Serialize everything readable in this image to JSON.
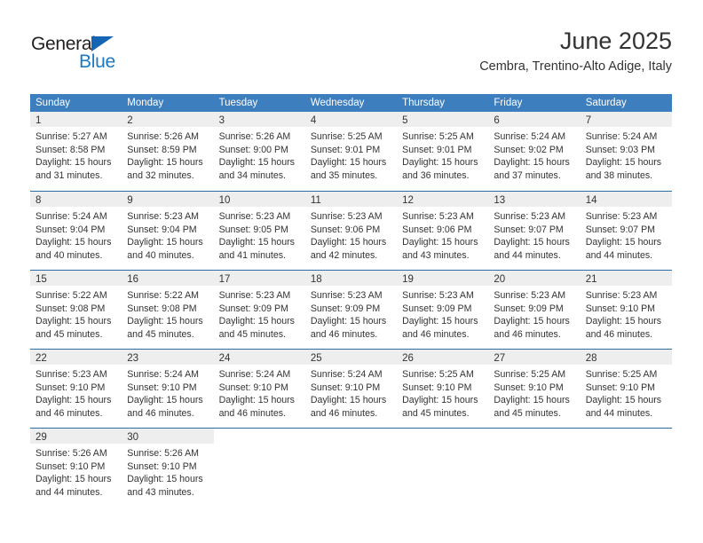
{
  "branding": {
    "logo_text_primary": "General",
    "logo_text_secondary": "Blue",
    "accent_blue": "#1a7ac4",
    "triangle_blue": "#1565b5"
  },
  "header": {
    "title": "June 2025",
    "subtitle": "Cembra, Trentino-Alto Adige, Italy"
  },
  "theme": {
    "header_row_bg": "#3d7ebf",
    "row_divider": "#2e6da4",
    "day_number_bg": "#eeeeee",
    "text_color": "#333333"
  },
  "weekdays": [
    "Sunday",
    "Monday",
    "Tuesday",
    "Wednesday",
    "Thursday",
    "Friday",
    "Saturday"
  ],
  "weeks": [
    [
      {
        "day": "1",
        "lines": [
          "Sunrise: 5:27 AM",
          "Sunset: 8:58 PM",
          "Daylight: 15 hours",
          "and 31 minutes."
        ]
      },
      {
        "day": "2",
        "lines": [
          "Sunrise: 5:26 AM",
          "Sunset: 8:59 PM",
          "Daylight: 15 hours",
          "and 32 minutes."
        ]
      },
      {
        "day": "3",
        "lines": [
          "Sunrise: 5:26 AM",
          "Sunset: 9:00 PM",
          "Daylight: 15 hours",
          "and 34 minutes."
        ]
      },
      {
        "day": "4",
        "lines": [
          "Sunrise: 5:25 AM",
          "Sunset: 9:01 PM",
          "Daylight: 15 hours",
          "and 35 minutes."
        ]
      },
      {
        "day": "5",
        "lines": [
          "Sunrise: 5:25 AM",
          "Sunset: 9:01 PM",
          "Daylight: 15 hours",
          "and 36 minutes."
        ]
      },
      {
        "day": "6",
        "lines": [
          "Sunrise: 5:24 AM",
          "Sunset: 9:02 PM",
          "Daylight: 15 hours",
          "and 37 minutes."
        ]
      },
      {
        "day": "7",
        "lines": [
          "Sunrise: 5:24 AM",
          "Sunset: 9:03 PM",
          "Daylight: 15 hours",
          "and 38 minutes."
        ]
      }
    ],
    [
      {
        "day": "8",
        "lines": [
          "Sunrise: 5:24 AM",
          "Sunset: 9:04 PM",
          "Daylight: 15 hours",
          "and 40 minutes."
        ]
      },
      {
        "day": "9",
        "lines": [
          "Sunrise: 5:23 AM",
          "Sunset: 9:04 PM",
          "Daylight: 15 hours",
          "and 40 minutes."
        ]
      },
      {
        "day": "10",
        "lines": [
          "Sunrise: 5:23 AM",
          "Sunset: 9:05 PM",
          "Daylight: 15 hours",
          "and 41 minutes."
        ]
      },
      {
        "day": "11",
        "lines": [
          "Sunrise: 5:23 AM",
          "Sunset: 9:06 PM",
          "Daylight: 15 hours",
          "and 42 minutes."
        ]
      },
      {
        "day": "12",
        "lines": [
          "Sunrise: 5:23 AM",
          "Sunset: 9:06 PM",
          "Daylight: 15 hours",
          "and 43 minutes."
        ]
      },
      {
        "day": "13",
        "lines": [
          "Sunrise: 5:23 AM",
          "Sunset: 9:07 PM",
          "Daylight: 15 hours",
          "and 44 minutes."
        ]
      },
      {
        "day": "14",
        "lines": [
          "Sunrise: 5:23 AM",
          "Sunset: 9:07 PM",
          "Daylight: 15 hours",
          "and 44 minutes."
        ]
      }
    ],
    [
      {
        "day": "15",
        "lines": [
          "Sunrise: 5:22 AM",
          "Sunset: 9:08 PM",
          "Daylight: 15 hours",
          "and 45 minutes."
        ]
      },
      {
        "day": "16",
        "lines": [
          "Sunrise: 5:22 AM",
          "Sunset: 9:08 PM",
          "Daylight: 15 hours",
          "and 45 minutes."
        ]
      },
      {
        "day": "17",
        "lines": [
          "Sunrise: 5:23 AM",
          "Sunset: 9:09 PM",
          "Daylight: 15 hours",
          "and 45 minutes."
        ]
      },
      {
        "day": "18",
        "lines": [
          "Sunrise: 5:23 AM",
          "Sunset: 9:09 PM",
          "Daylight: 15 hours",
          "and 46 minutes."
        ]
      },
      {
        "day": "19",
        "lines": [
          "Sunrise: 5:23 AM",
          "Sunset: 9:09 PM",
          "Daylight: 15 hours",
          "and 46 minutes."
        ]
      },
      {
        "day": "20",
        "lines": [
          "Sunrise: 5:23 AM",
          "Sunset: 9:09 PM",
          "Daylight: 15 hours",
          "and 46 minutes."
        ]
      },
      {
        "day": "21",
        "lines": [
          "Sunrise: 5:23 AM",
          "Sunset: 9:10 PM",
          "Daylight: 15 hours",
          "and 46 minutes."
        ]
      }
    ],
    [
      {
        "day": "22",
        "lines": [
          "Sunrise: 5:23 AM",
          "Sunset: 9:10 PM",
          "Daylight: 15 hours",
          "and 46 minutes."
        ]
      },
      {
        "day": "23",
        "lines": [
          "Sunrise: 5:24 AM",
          "Sunset: 9:10 PM",
          "Daylight: 15 hours",
          "and 46 minutes."
        ]
      },
      {
        "day": "24",
        "lines": [
          "Sunrise: 5:24 AM",
          "Sunset: 9:10 PM",
          "Daylight: 15 hours",
          "and 46 minutes."
        ]
      },
      {
        "day": "25",
        "lines": [
          "Sunrise: 5:24 AM",
          "Sunset: 9:10 PM",
          "Daylight: 15 hours",
          "and 46 minutes."
        ]
      },
      {
        "day": "26",
        "lines": [
          "Sunrise: 5:25 AM",
          "Sunset: 9:10 PM",
          "Daylight: 15 hours",
          "and 45 minutes."
        ]
      },
      {
        "day": "27",
        "lines": [
          "Sunrise: 5:25 AM",
          "Sunset: 9:10 PM",
          "Daylight: 15 hours",
          "and 45 minutes."
        ]
      },
      {
        "day": "28",
        "lines": [
          "Sunrise: 5:25 AM",
          "Sunset: 9:10 PM",
          "Daylight: 15 hours",
          "and 44 minutes."
        ]
      }
    ],
    [
      {
        "day": "29",
        "lines": [
          "Sunrise: 5:26 AM",
          "Sunset: 9:10 PM",
          "Daylight: 15 hours",
          "and 44 minutes."
        ]
      },
      {
        "day": "30",
        "lines": [
          "Sunrise: 5:26 AM",
          "Sunset: 9:10 PM",
          "Daylight: 15 hours",
          "and 43 minutes."
        ]
      },
      {
        "day": "",
        "lines": []
      },
      {
        "day": "",
        "lines": []
      },
      {
        "day": "",
        "lines": []
      },
      {
        "day": "",
        "lines": []
      },
      {
        "day": "",
        "lines": []
      }
    ]
  ]
}
